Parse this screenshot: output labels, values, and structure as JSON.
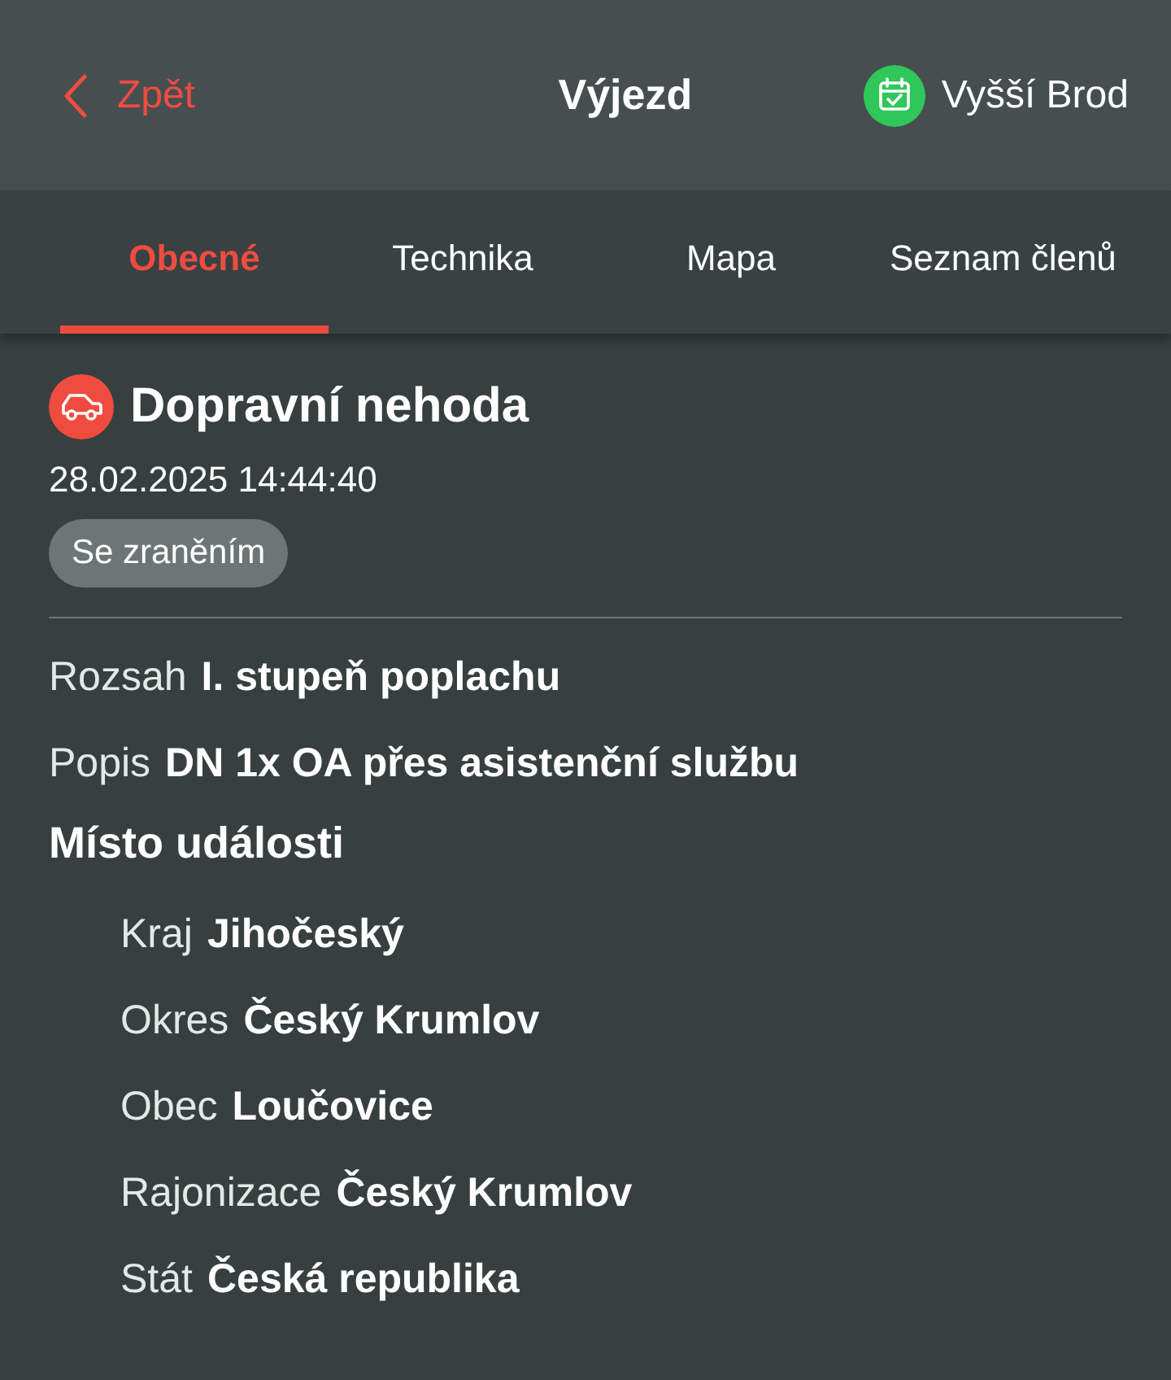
{
  "header": {
    "back": "Zpět",
    "title": "Výjezd",
    "unit": "Vyšší Brod"
  },
  "tabs": [
    {
      "label": "Obecné",
      "selected": true
    },
    {
      "label": "Technika",
      "selected": false
    },
    {
      "label": "Mapa",
      "selected": false
    },
    {
      "label": "Seznam členů",
      "selected": false
    }
  ],
  "event": {
    "title": "Dopravní nehoda",
    "datetime": "28.02.2025 14:44:40",
    "tag": "Se zraněním"
  },
  "details": [
    {
      "label": "Rozsah",
      "value": "I. stupeň poplachu"
    },
    {
      "label": "Popis",
      "value": "DN 1x OA přes asistenční službu"
    }
  ],
  "location": {
    "heading": "Místo události",
    "rows": [
      {
        "label": "Kraj",
        "value": "Jihočeský"
      },
      {
        "label": "Okres",
        "value": "Český Krumlov"
      },
      {
        "label": "Obec",
        "value": "Loučovice"
      },
      {
        "label": "Rajonizace",
        "value": "Český Krumlov"
      },
      {
        "label": "Stát",
        "value": "Česká republika"
      }
    ]
  }
}
